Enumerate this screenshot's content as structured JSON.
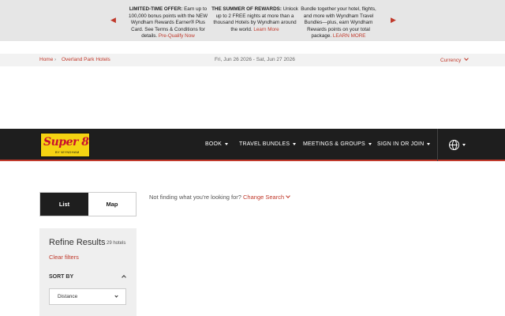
{
  "promos": [
    {
      "bold": "LIMITED-TIME OFFER:",
      "text": " Earn up to 100,000 bonus points with the NEW Wyndham Rewards Earner® Plus Card. See Terms & Conditions for details. ",
      "link": "Pre-Qualify Now"
    },
    {
      "bold": "THE SUMMER OF REWARDS:",
      "text": " Unlock up to 2 FREE nights at more than a thousand Hotels by Wyndham around the world. ",
      "link": "Learn More"
    },
    {
      "bold": "",
      "text": "Bundle together your hotel, flights, and more with Wyndham Travel Bundles—plus, earn Wyndham Rewards points on your total package. ",
      "link": "LEARN MORE"
    }
  ],
  "breadcrumb": {
    "home": "Home",
    "separator": "›",
    "city": "Overland Park Hotels"
  },
  "dates": "Fri, Jun 26 2026 - Sat, Jun 27 2026",
  "currency": "Currency",
  "logo": {
    "brand": "Super 8",
    "sub": "BY WYNDHAM"
  },
  "nav": {
    "book": "BOOK",
    "bundles": "TRAVEL BUNDLES",
    "meetings": "MEETINGS & GROUPS",
    "signin": "SIGN IN OR JOIN"
  },
  "view_toggle": {
    "list": "List",
    "map": "Map",
    "active": "List"
  },
  "not_finding": {
    "text": "Not finding what you're looking for? ",
    "link": "Change Search"
  },
  "refine": {
    "title": "Refine Results",
    "count": "29 hotels",
    "clear": "Clear filters",
    "sort_label": "SORT BY",
    "sort_value": "Distance"
  },
  "colors": {
    "accent": "#c0392b",
    "nav_bg": "#1e1e1e",
    "logo_yellow": "#f5d312"
  }
}
